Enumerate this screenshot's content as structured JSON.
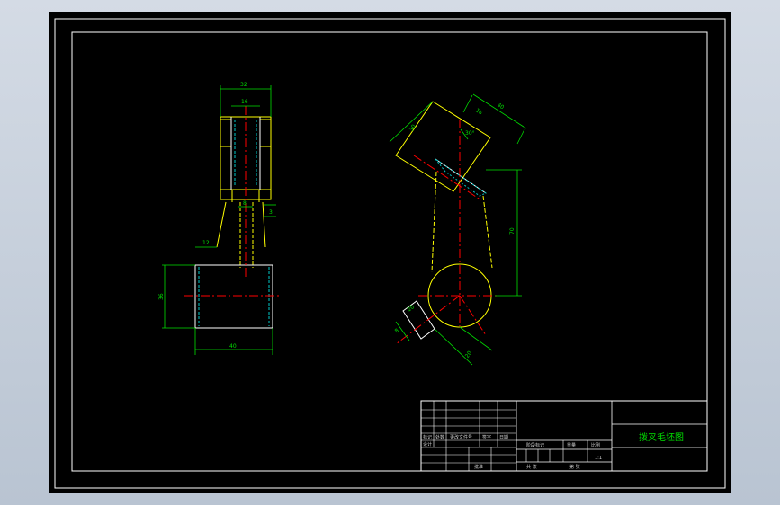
{
  "colors": {
    "background": "#000000",
    "frame": "#ffffff",
    "outline": "#ffff00",
    "dimension": "#00e000",
    "centerline": "#ff0000",
    "hidden": "#00c8c8"
  },
  "drawing": {
    "title": "拨叉毛坯图",
    "scale": "1:1",
    "left_view_dims": {
      "top_width": "32",
      "slot_width": "16",
      "shank_width": "8",
      "shank_side": "3",
      "step": "12",
      "boss_height": "36",
      "boss_width": "40"
    },
    "right_view_dims": {
      "block_width": "40",
      "block_height": "30",
      "slot_depth": "16",
      "angle": "30°",
      "arm_length": "70",
      "boss_dia": "20",
      "hole_dia": "20",
      "small_dim": "8"
    }
  },
  "title_block": {
    "cells": [
      "标记",
      "处数",
      "更改文件号",
      "签字",
      "日期"
    ],
    "row_design": "设计",
    "stage_label": "阶段标记",
    "weight_label": "重量",
    "scale_label": "比例",
    "sheet_label": "共 张",
    "sheet_no_label": "第 张",
    "approve_label": "批准"
  }
}
